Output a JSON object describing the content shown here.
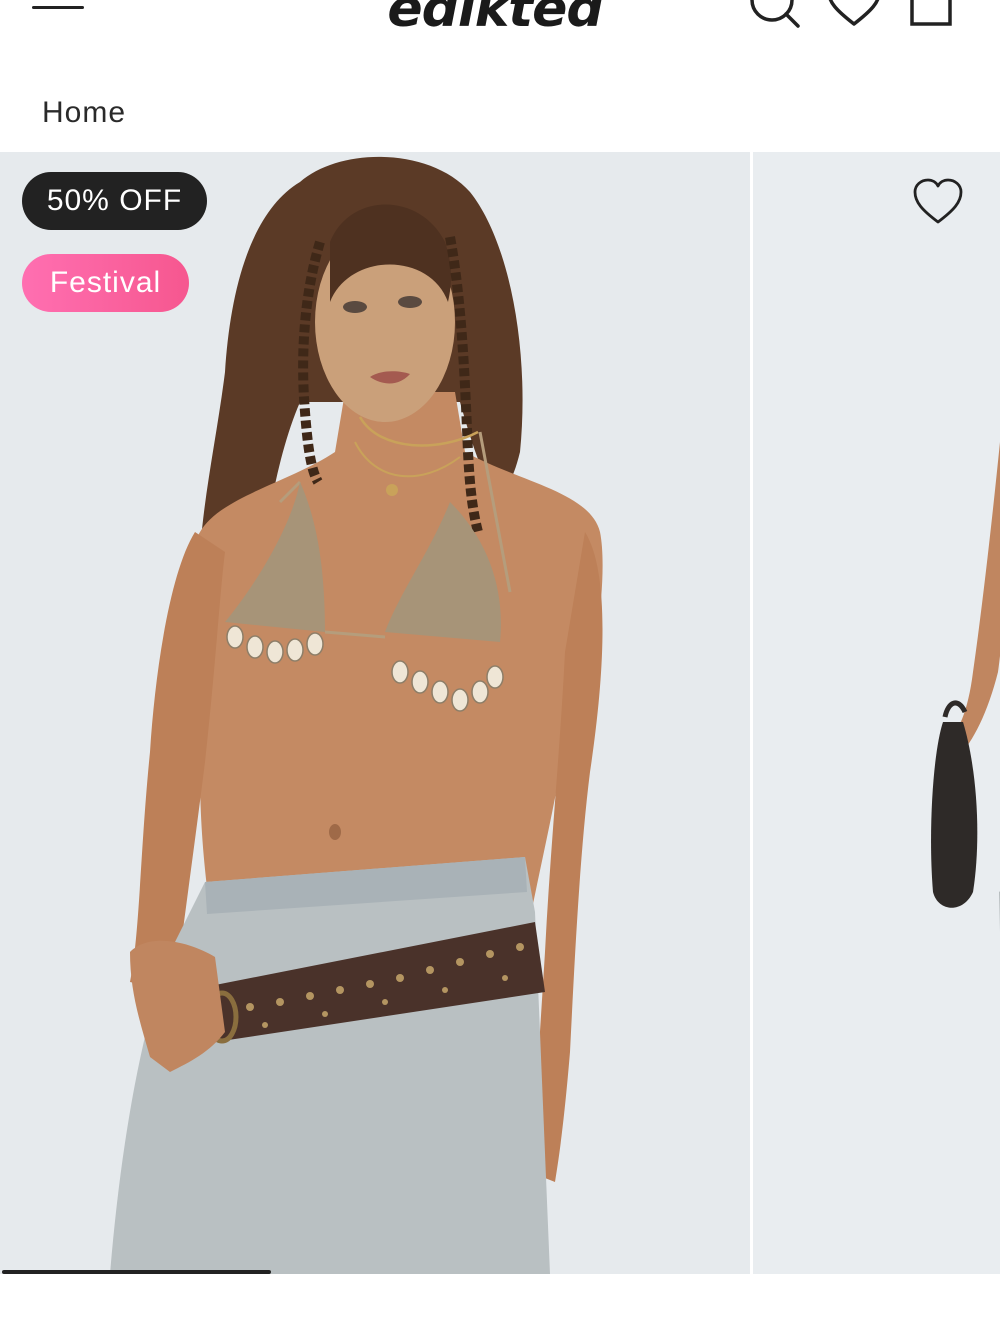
{
  "header": {
    "logo_text": "edikted",
    "menu_icon": "hamburger-menu-icon",
    "search_icon": "search-icon",
    "wishlist_icon": "heart-icon",
    "cart_icon": "bag-icon"
  },
  "breadcrumb": {
    "items": [
      "Home"
    ]
  },
  "product": {
    "badges": {
      "sale": "50% OFF",
      "tag": "Festival"
    },
    "wishlist_icon": "heart-outline-icon",
    "gallery": {
      "images": [
        "model-crochet-shell-bikini-top-front",
        "model-side-holding-bag"
      ],
      "progress": 0.27
    }
  },
  "colors": {
    "badge_sale_bg": "#222222",
    "badge_tag_bg": "#f75e9a",
    "image_bg": "#e7ebee"
  }
}
